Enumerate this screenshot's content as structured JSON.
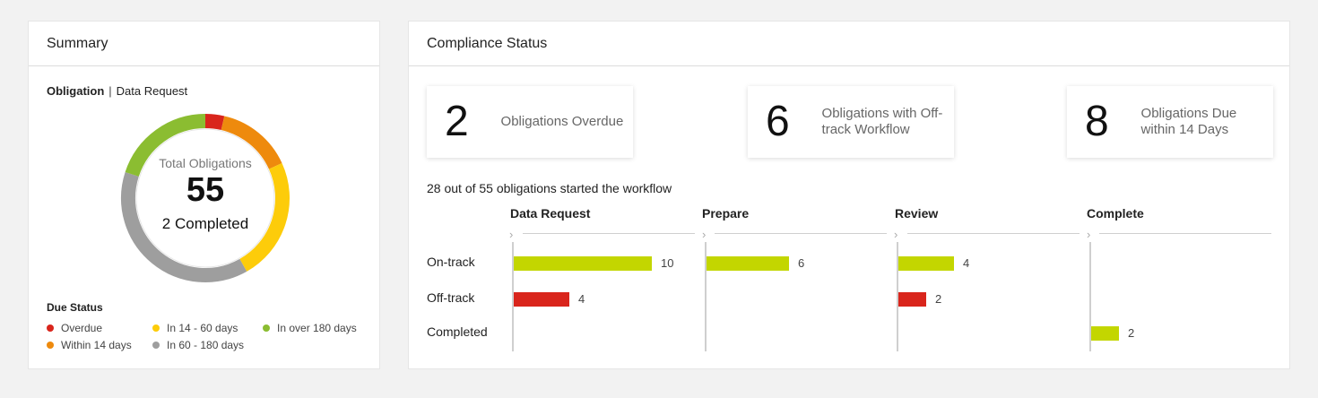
{
  "summary": {
    "title": "Summary",
    "toggle": {
      "active": "Obligation",
      "separator": "|",
      "inactive": "Data Request"
    },
    "donut": {
      "label": "Total Obligations",
      "total": "55",
      "completed": "2 Completed",
      "segments": [
        {
          "name": "Overdue",
          "value": 2,
          "color": "#d9251c"
        },
        {
          "name": "Within 14 days",
          "value": 8,
          "color": "#ee8a0d"
        },
        {
          "name": "In 14 - 60 days",
          "value": 13,
          "color": "#fdcc0a"
        },
        {
          "name": "In 60 - 180 days",
          "value": 21,
          "color": "#9e9e9e"
        },
        {
          "name": "In over 180 days",
          "value": 11,
          "color": "#8bbd31"
        }
      ]
    },
    "due_status": {
      "title": "Due Status",
      "items": [
        {
          "label": "Overdue",
          "color": "#d9251c"
        },
        {
          "label": "In 14 - 60 days",
          "color": "#fdcc0a"
        },
        {
          "label": "In over 180 days",
          "color": "#8bbd31"
        },
        {
          "label": "Within 14 days",
          "color": "#ee8a0d"
        },
        {
          "label": "In 60 - 180 days",
          "color": "#9e9e9e"
        }
      ]
    }
  },
  "compliance": {
    "title": "Compliance Status",
    "stats": [
      {
        "number": "2",
        "text": "Obligations Overdue"
      },
      {
        "number": "6",
        "text": "Obligations with Off-track Workflow"
      },
      {
        "number": "8",
        "text": "Obligations Due within 14 Days"
      }
    ],
    "started_text": "28 out of 55 obligations started the workflow",
    "stages": [
      "Data Request",
      "Prepare",
      "Review",
      "Complete"
    ],
    "rows": [
      "On-track",
      "Off-track",
      "Completed"
    ],
    "bars": [
      {
        "stage": 0,
        "row": 0,
        "value": 10,
        "label": "10",
        "color": "#c3d600"
      },
      {
        "stage": 0,
        "row": 1,
        "value": 4,
        "label": "4",
        "color": "#d9251c"
      },
      {
        "stage": 1,
        "row": 0,
        "value": 6,
        "label": "6",
        "color": "#c3d600"
      },
      {
        "stage": 2,
        "row": 0,
        "value": 4,
        "label": "4",
        "color": "#c3d600"
      },
      {
        "stage": 2,
        "row": 1,
        "value": 2,
        "label": "2",
        "color": "#d9251c"
      },
      {
        "stage": 3,
        "row": 2,
        "value": 2,
        "label": "2",
        "color": "#c3d600"
      }
    ],
    "chevron": "›"
  }
}
